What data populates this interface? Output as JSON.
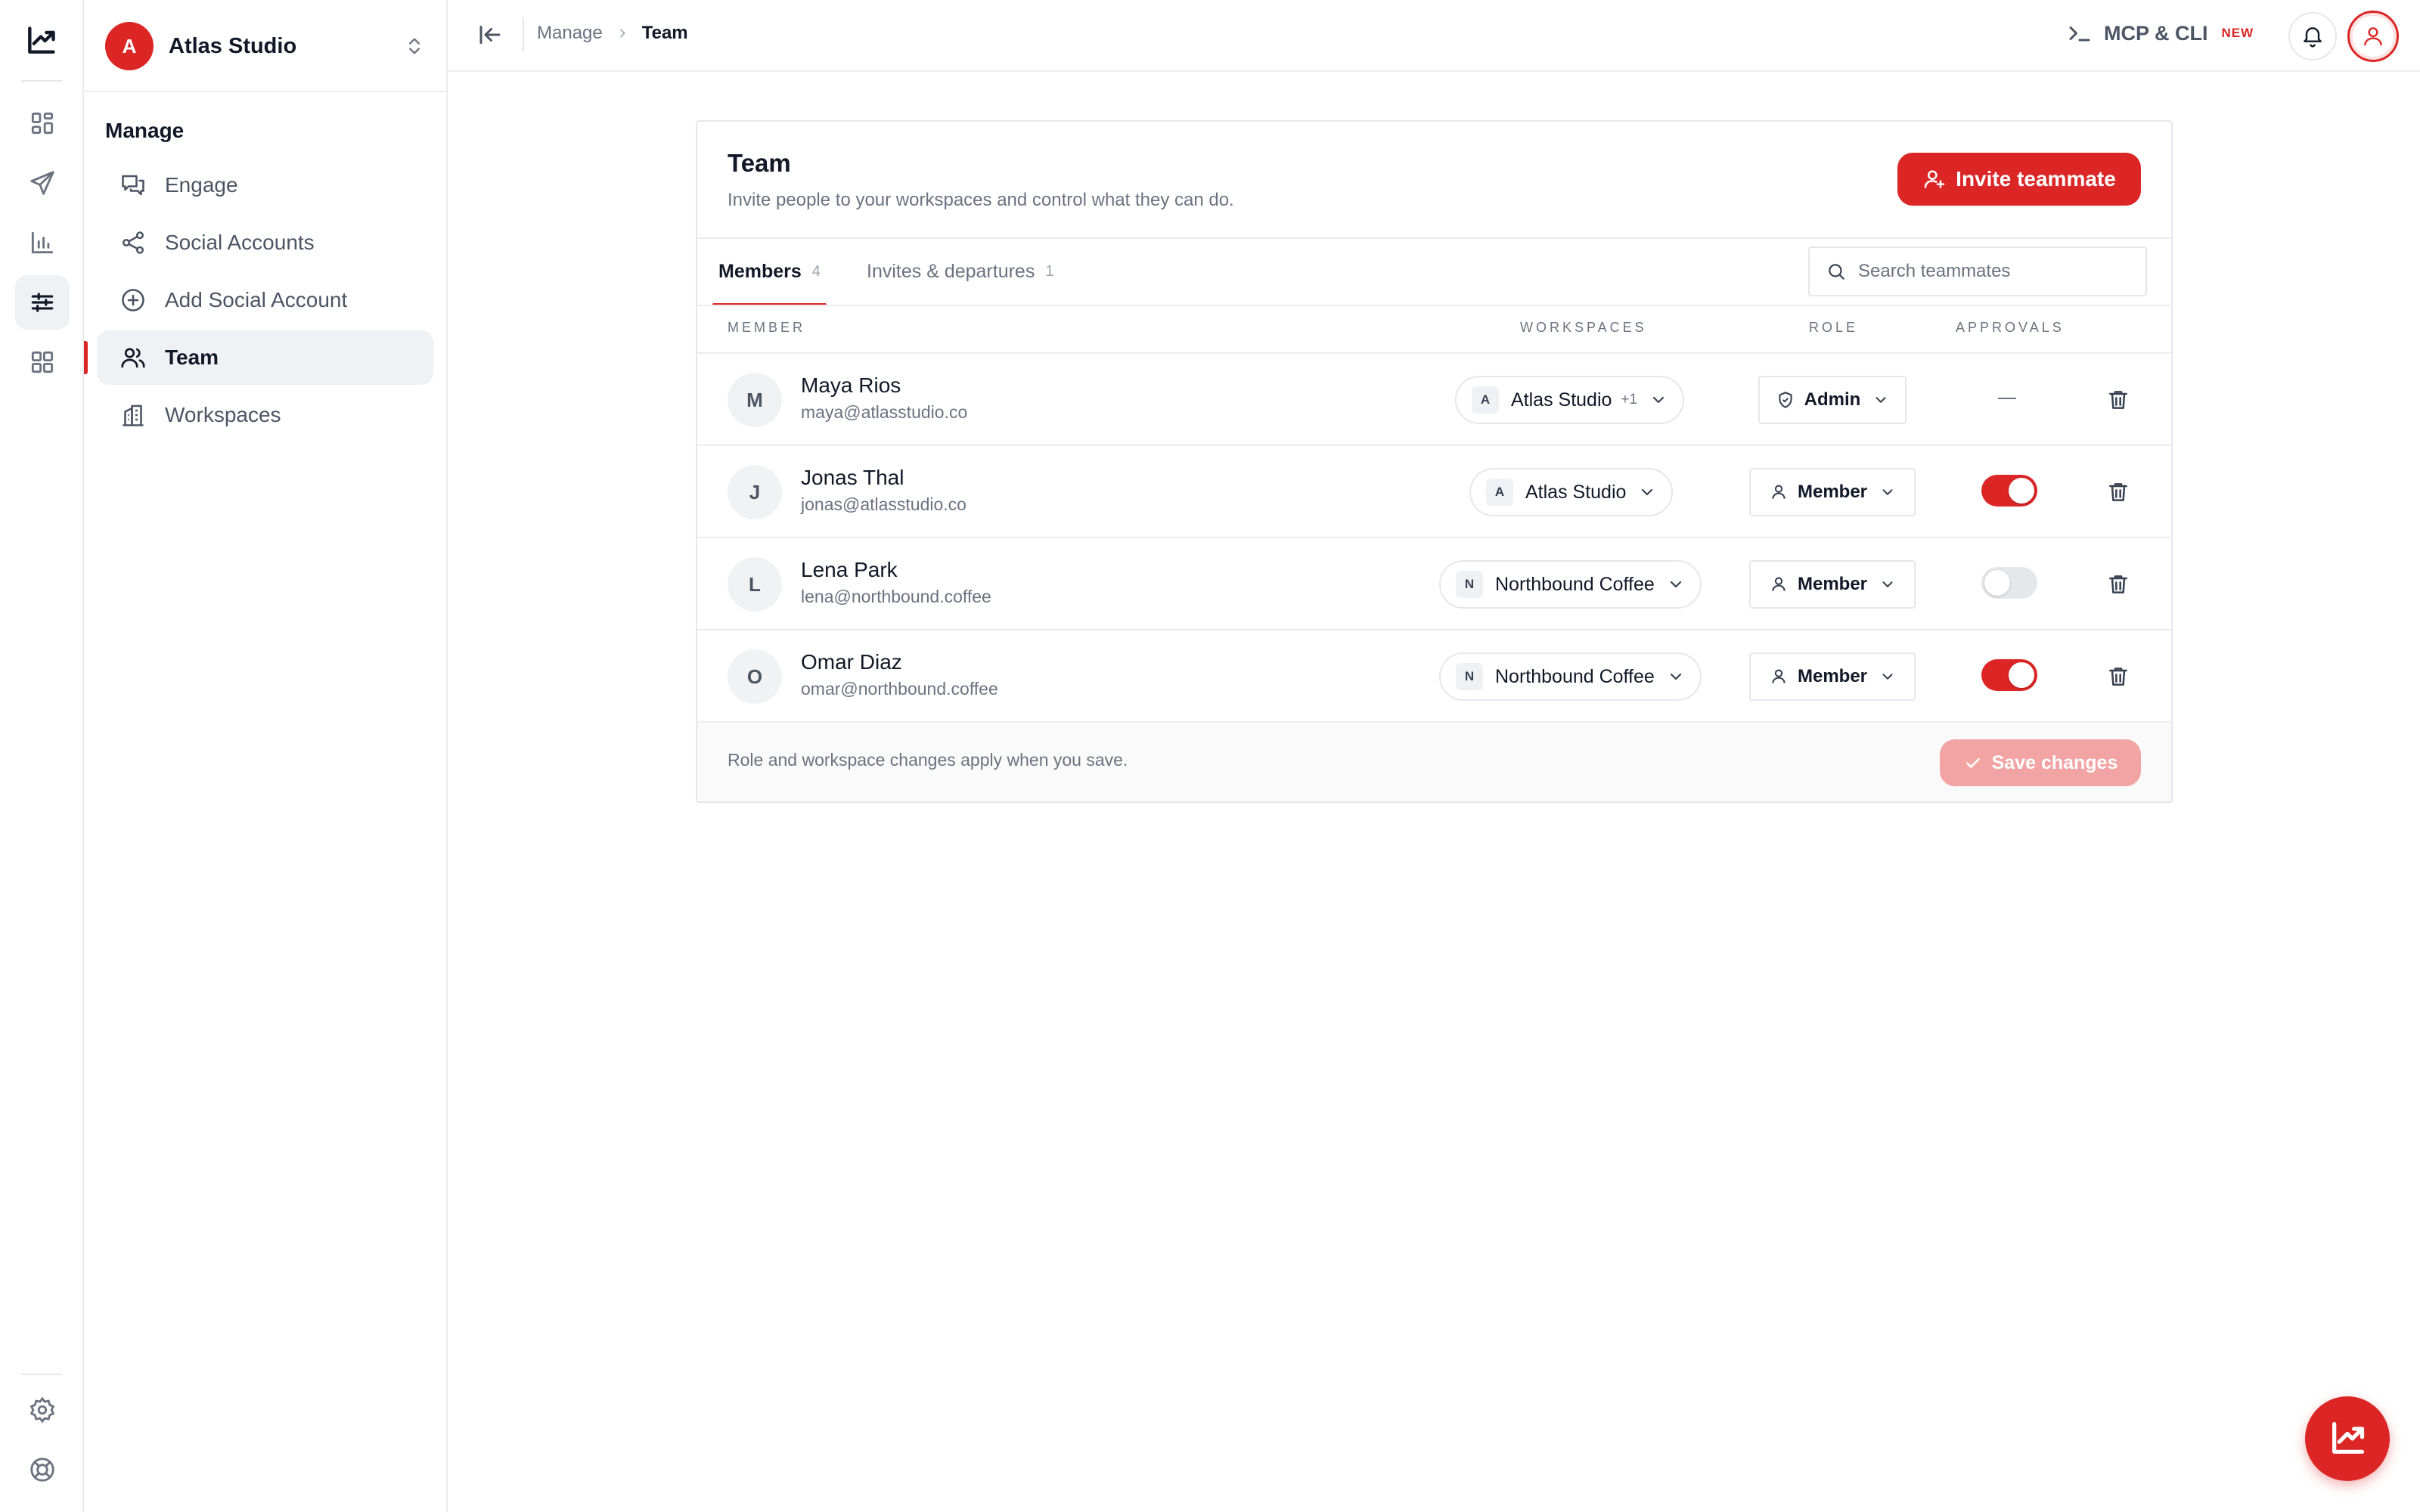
{
  "colors": {
    "accent": "#dc2626",
    "accent_disabled": "#f2a3a3",
    "muted_text": "#6b7280"
  },
  "rail": {
    "items": [
      {
        "name": "dashboard",
        "icon": "grid-icon",
        "active": false
      },
      {
        "name": "publish",
        "icon": "send-icon",
        "active": false
      },
      {
        "name": "analytics",
        "icon": "bar-chart-icon",
        "active": false
      },
      {
        "name": "manage",
        "icon": "sliders-icon",
        "active": true
      },
      {
        "name": "apps",
        "icon": "apps-grid-icon",
        "active": false
      }
    ],
    "bottom": [
      {
        "name": "settings",
        "icon": "gear-icon"
      },
      {
        "name": "help",
        "icon": "lifebuoy-icon"
      }
    ]
  },
  "workspace": {
    "initial": "A",
    "name": "Atlas Studio"
  },
  "nav": {
    "heading": "Manage",
    "items": [
      {
        "label": "Engage",
        "icon": "chat-icon",
        "active": false
      },
      {
        "label": "Social Accounts",
        "icon": "share-icon",
        "active": false
      },
      {
        "label": "Add Social Account",
        "icon": "plus-circle-icon",
        "active": false
      },
      {
        "label": "Team",
        "icon": "users-icon",
        "active": true
      },
      {
        "label": "Workspaces",
        "icon": "building-icon",
        "active": false
      }
    ]
  },
  "topbar": {
    "breadcrumb": [
      "Manage",
      "Team"
    ],
    "mcp_label": "MCP & CLI",
    "new_badge": "NEW"
  },
  "team": {
    "title": "Team",
    "subtitle": "Invite people to your workspaces and control what they can do.",
    "invite_label": "Invite teammate",
    "tabs": [
      {
        "label": "Members",
        "count": "4",
        "active": true
      },
      {
        "label": "Invites & departures",
        "count": "1",
        "active": false
      }
    ],
    "search_placeholder": "Search teammates",
    "columns": {
      "member": "MEMBER",
      "workspaces": "WORKSPACES",
      "role": "ROLE",
      "approvals": "APPROVALS"
    },
    "members": [
      {
        "initial": "M",
        "name": "Maya Rios",
        "email": "maya@atlasstudio.co",
        "ws_initial": "A",
        "workspace": "Atlas Studio",
        "ws_extra": "+1",
        "role": "Admin",
        "role_icon": "shield-icon",
        "approvals": "—"
      },
      {
        "initial": "J",
        "name": "Jonas Thal",
        "email": "jonas@atlasstudio.co",
        "ws_initial": "A",
        "workspace": "Atlas Studio",
        "ws_extra": "",
        "role": "Member",
        "role_icon": "user-icon",
        "approvals": true
      },
      {
        "initial": "L",
        "name": "Lena Park",
        "email": "lena@northbound.coffee",
        "ws_initial": "N",
        "workspace": "Northbound Coffee",
        "ws_extra": "",
        "role": "Member",
        "role_icon": "user-icon",
        "approvals": false
      },
      {
        "initial": "O",
        "name": "Omar Diaz",
        "email": "omar@northbound.coffee",
        "ws_initial": "N",
        "workspace": "Northbound Coffee",
        "ws_extra": "",
        "role": "Member",
        "role_icon": "user-icon",
        "approvals": true
      }
    ],
    "footer_note": "Role and workspace changes apply when you save.",
    "save_label": "Save changes"
  }
}
